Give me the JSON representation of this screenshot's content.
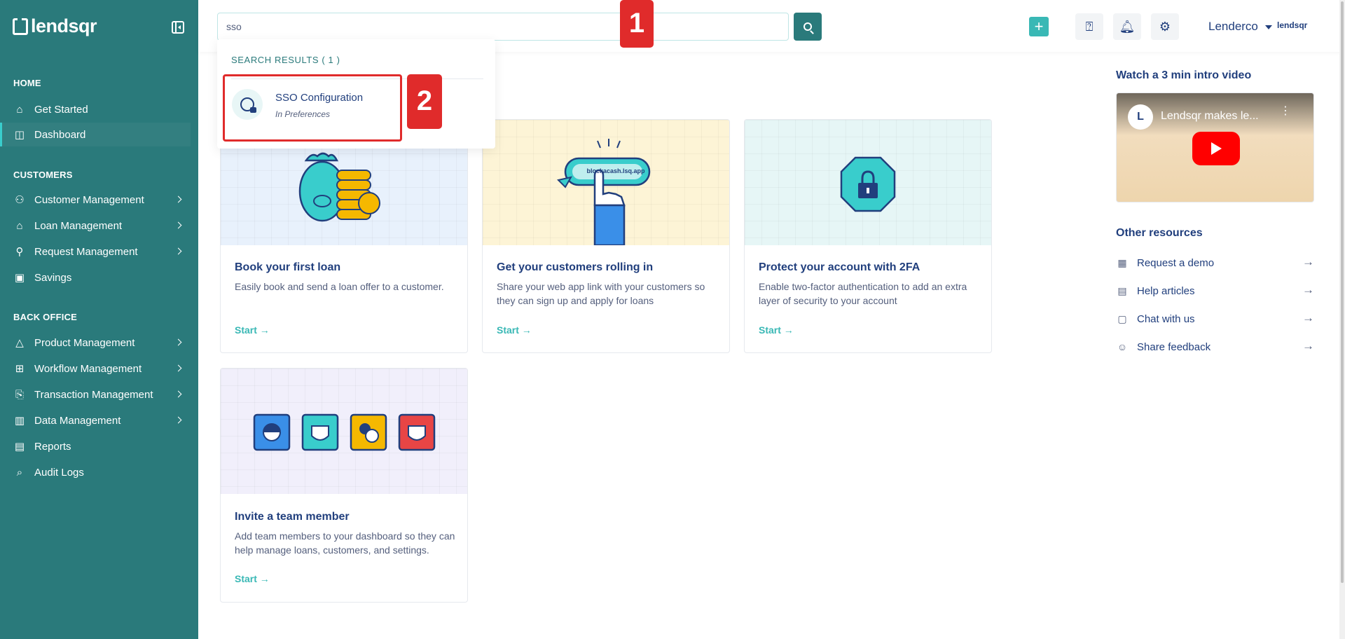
{
  "brand": {
    "name": "lendsqr",
    "mini_logo": "lendsqr"
  },
  "sidebar": {
    "sections": [
      {
        "title": "HOME",
        "items": [
          {
            "label": "Get Started",
            "icon": "home-icon",
            "chevron": false,
            "active": false
          },
          {
            "label": "Dashboard",
            "icon": "dashboard-icon",
            "chevron": false,
            "active": true
          }
        ]
      },
      {
        "title": "CUSTOMERS",
        "items": [
          {
            "label": "Customer Management",
            "icon": "users-icon",
            "chevron": true
          },
          {
            "label": "Loan Management",
            "icon": "bank-icon",
            "chevron": true
          },
          {
            "label": "Request Management",
            "icon": "request-icon",
            "chevron": true
          },
          {
            "label": "Savings",
            "icon": "briefcase-icon",
            "chevron": false
          }
        ]
      },
      {
        "title": "BACK OFFICE",
        "items": [
          {
            "label": "Product Management",
            "icon": "product-icon",
            "chevron": true
          },
          {
            "label": "Workflow Management",
            "icon": "workflow-icon",
            "chevron": true
          },
          {
            "label": "Transaction Management",
            "icon": "transaction-icon",
            "chevron": true
          },
          {
            "label": "Data Management",
            "icon": "chart-icon",
            "chevron": true
          },
          {
            "label": "Reports",
            "icon": "report-icon",
            "chevron": false
          },
          {
            "label": "Audit Logs",
            "icon": "audit-icon",
            "chevron": false
          }
        ]
      }
    ]
  },
  "search": {
    "value": "sso",
    "placeholder": ""
  },
  "header": {
    "user_name": "Lenderco",
    "plus_label": "+"
  },
  "badges": {
    "one": "1",
    "two": "2"
  },
  "dropdown": {
    "header": "SEARCH RESULTS ( 1 )",
    "results": [
      {
        "title": "SSO Configuration",
        "subtitle": "In Preferences"
      }
    ]
  },
  "cards": [
    {
      "title": "Book your first loan",
      "desc": "Easily book and send a loan offer to a customer.",
      "link": "Start →",
      "bg": "#e8f1fc"
    },
    {
      "title": "Get your customers rolling in",
      "desc": "Share your web app link with your customers so they can sign up and apply for loans",
      "link": "Start →",
      "bg": "#fdf4d6",
      "url_label": "blockacash.lsq.app"
    },
    {
      "title": "Protect your account with 2FA",
      "desc": "Enable two-factor authentication to add an extra layer of security to your account",
      "link": "Start →",
      "bg": "#e6f6f6"
    },
    {
      "title": "Invite a team member",
      "desc": "Add team members to your dashboard so they can help manage loans, customers, and settings.",
      "link": "Start →",
      "bg": "#f1effb"
    }
  ],
  "video": {
    "heading": "Watch a 3 min intro video",
    "title": "Lendsqr makes le..."
  },
  "resources": {
    "heading": "Other resources",
    "items": [
      {
        "label": "Request a demo",
        "icon": "calendar-icon"
      },
      {
        "label": "Help articles",
        "icon": "document-icon"
      },
      {
        "label": "Chat with us",
        "icon": "chat-icon"
      },
      {
        "label": "Share feedback",
        "icon": "feedback-icon"
      }
    ]
  },
  "colors": {
    "sidebar": "#2a7a7b",
    "accent": "#39b8b5",
    "text": "#213f7d",
    "badge": "#e02b2b"
  }
}
